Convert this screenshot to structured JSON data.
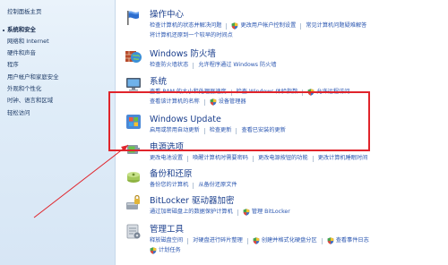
{
  "sidebar": {
    "home": "控制面板主页",
    "items": [
      {
        "label": "系统和安全",
        "current": true
      },
      {
        "label": "网络和 Internet"
      },
      {
        "label": "硬件和声音"
      },
      {
        "label": "程序"
      },
      {
        "label": "用户帐户和家庭安全"
      },
      {
        "label": "外观和个性化"
      },
      {
        "label": "时钟、语言和区域"
      },
      {
        "label": "轻松访问"
      }
    ]
  },
  "categories": {
    "action_center": {
      "title": "操作中心",
      "row1": [
        "检查计算机的状态并解决问题",
        "更改用户帐户控制设置",
        "常见计算机问题疑难解答"
      ],
      "row2": [
        "将计算机还原到一个较早的时间点"
      ]
    },
    "firewall": {
      "title": "Windows 防火墙",
      "row1": [
        "检查防火墙状态",
        "允许程序通过 Windows 防火墙"
      ]
    },
    "system": {
      "title": "系统",
      "row1": [
        "查看 RAM 的大小和处理器速度",
        "检查 Windows 体验指数",
        "允许远程访问"
      ],
      "row2": [
        "查看该计算机的名称",
        "设备管理器"
      ]
    },
    "windows_update": {
      "title": "Windows Update",
      "row1": [
        "启用或禁用自动更新",
        "检查更新",
        "查看已安装的更新"
      ]
    },
    "power": {
      "title": "电源选项",
      "row1": [
        "更改电池设置",
        "唤醒计算机时需要密码",
        "更改电源按钮的功能",
        "更改计算机睡眠时间"
      ]
    },
    "backup": {
      "title": "备份和还原",
      "row1": [
        "备份您的计算机",
        "从备份还原文件"
      ]
    },
    "bitlocker": {
      "title": "BitLocker 驱动器加密",
      "row1": [
        "通过加密磁盘上的数据保护计算机",
        "管理 BitLocker"
      ]
    },
    "admin_tools": {
      "title": "管理工具",
      "row1": [
        "释放磁盘空间",
        "对硬盘进行碎片整理",
        "创建并格式化硬盘分区",
        "查看事件日志"
      ],
      "row2": [
        "计划任务"
      ]
    }
  },
  "colors": {
    "highlight": "#e0242b",
    "link": "#2a56b0",
    "title": "#1a3e8c"
  }
}
